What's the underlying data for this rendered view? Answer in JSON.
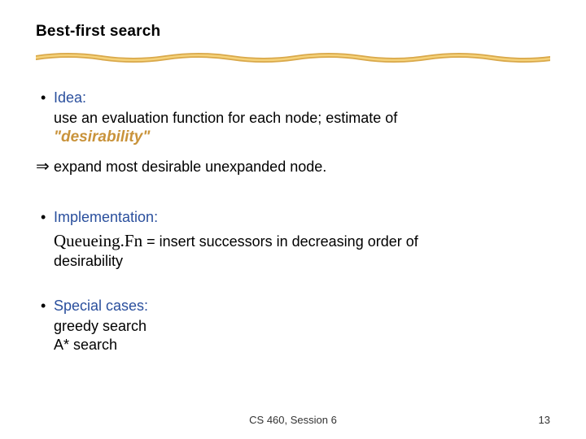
{
  "title": "Best-first search",
  "idea": {
    "label": "Idea:",
    "line1": "use an evaluation function for each node; estimate of",
    "desirability": "\"desirability\"",
    "arrow_text": "expand most desirable unexpanded node."
  },
  "implementation": {
    "label": "Implementation:",
    "qfn": "Queueing.Fn",
    "rest": " = insert successors in decreasing order of",
    "line2": "desirability"
  },
  "special": {
    "label": "Special cases:",
    "case1": "greedy search",
    "case2": "A* search"
  },
  "footer": {
    "center": "CS 460,  Session 6",
    "page": "13"
  },
  "glyphs": {
    "bullet": "•",
    "double_arrow": "⇒"
  },
  "colors": {
    "heading_blue": "#2a4f9d",
    "accent_gold": "#c9933b"
  }
}
